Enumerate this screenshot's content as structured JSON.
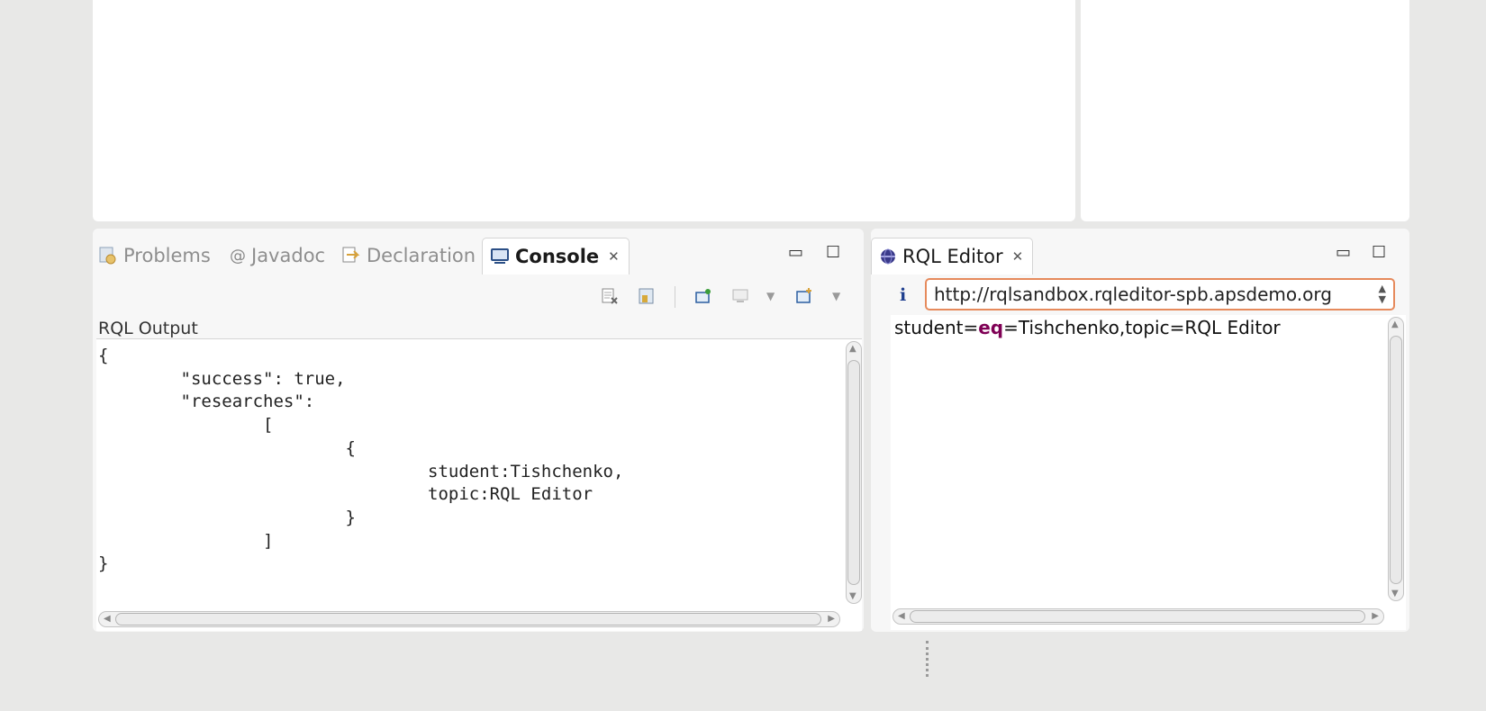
{
  "console_view": {
    "tabs": [
      {
        "label": "Problems",
        "icon": "problems-icon"
      },
      {
        "label": "Javadoc",
        "icon": "at-icon"
      },
      {
        "label": "Declaration",
        "icon": "declaration-icon"
      },
      {
        "label": "Console",
        "icon": "console-icon",
        "active": true
      }
    ],
    "output_label": "RQL Output",
    "output_lines": [
      "{",
      "        \"success\": true,",
      "        \"researches\":",
      "                [",
      "                        {",
      "                                student:Tishchenko,",
      "                                topic:RQL Editor",
      "                        }",
      "                ]",
      "}"
    ]
  },
  "rql_editor": {
    "tab_label": "RQL Editor",
    "info_icon": "i",
    "url_value": "http://rqlsandbox.rqleditor-spb.apsdemo.org",
    "query": {
      "part1": "student=",
      "operator": "eq",
      "part2": "=Tishchenko,topic=RQL Editor"
    }
  },
  "colors": {
    "background": "#e8e8e7",
    "operator_keyword": "#7f0055",
    "url_field_border": "#e68a5c"
  }
}
